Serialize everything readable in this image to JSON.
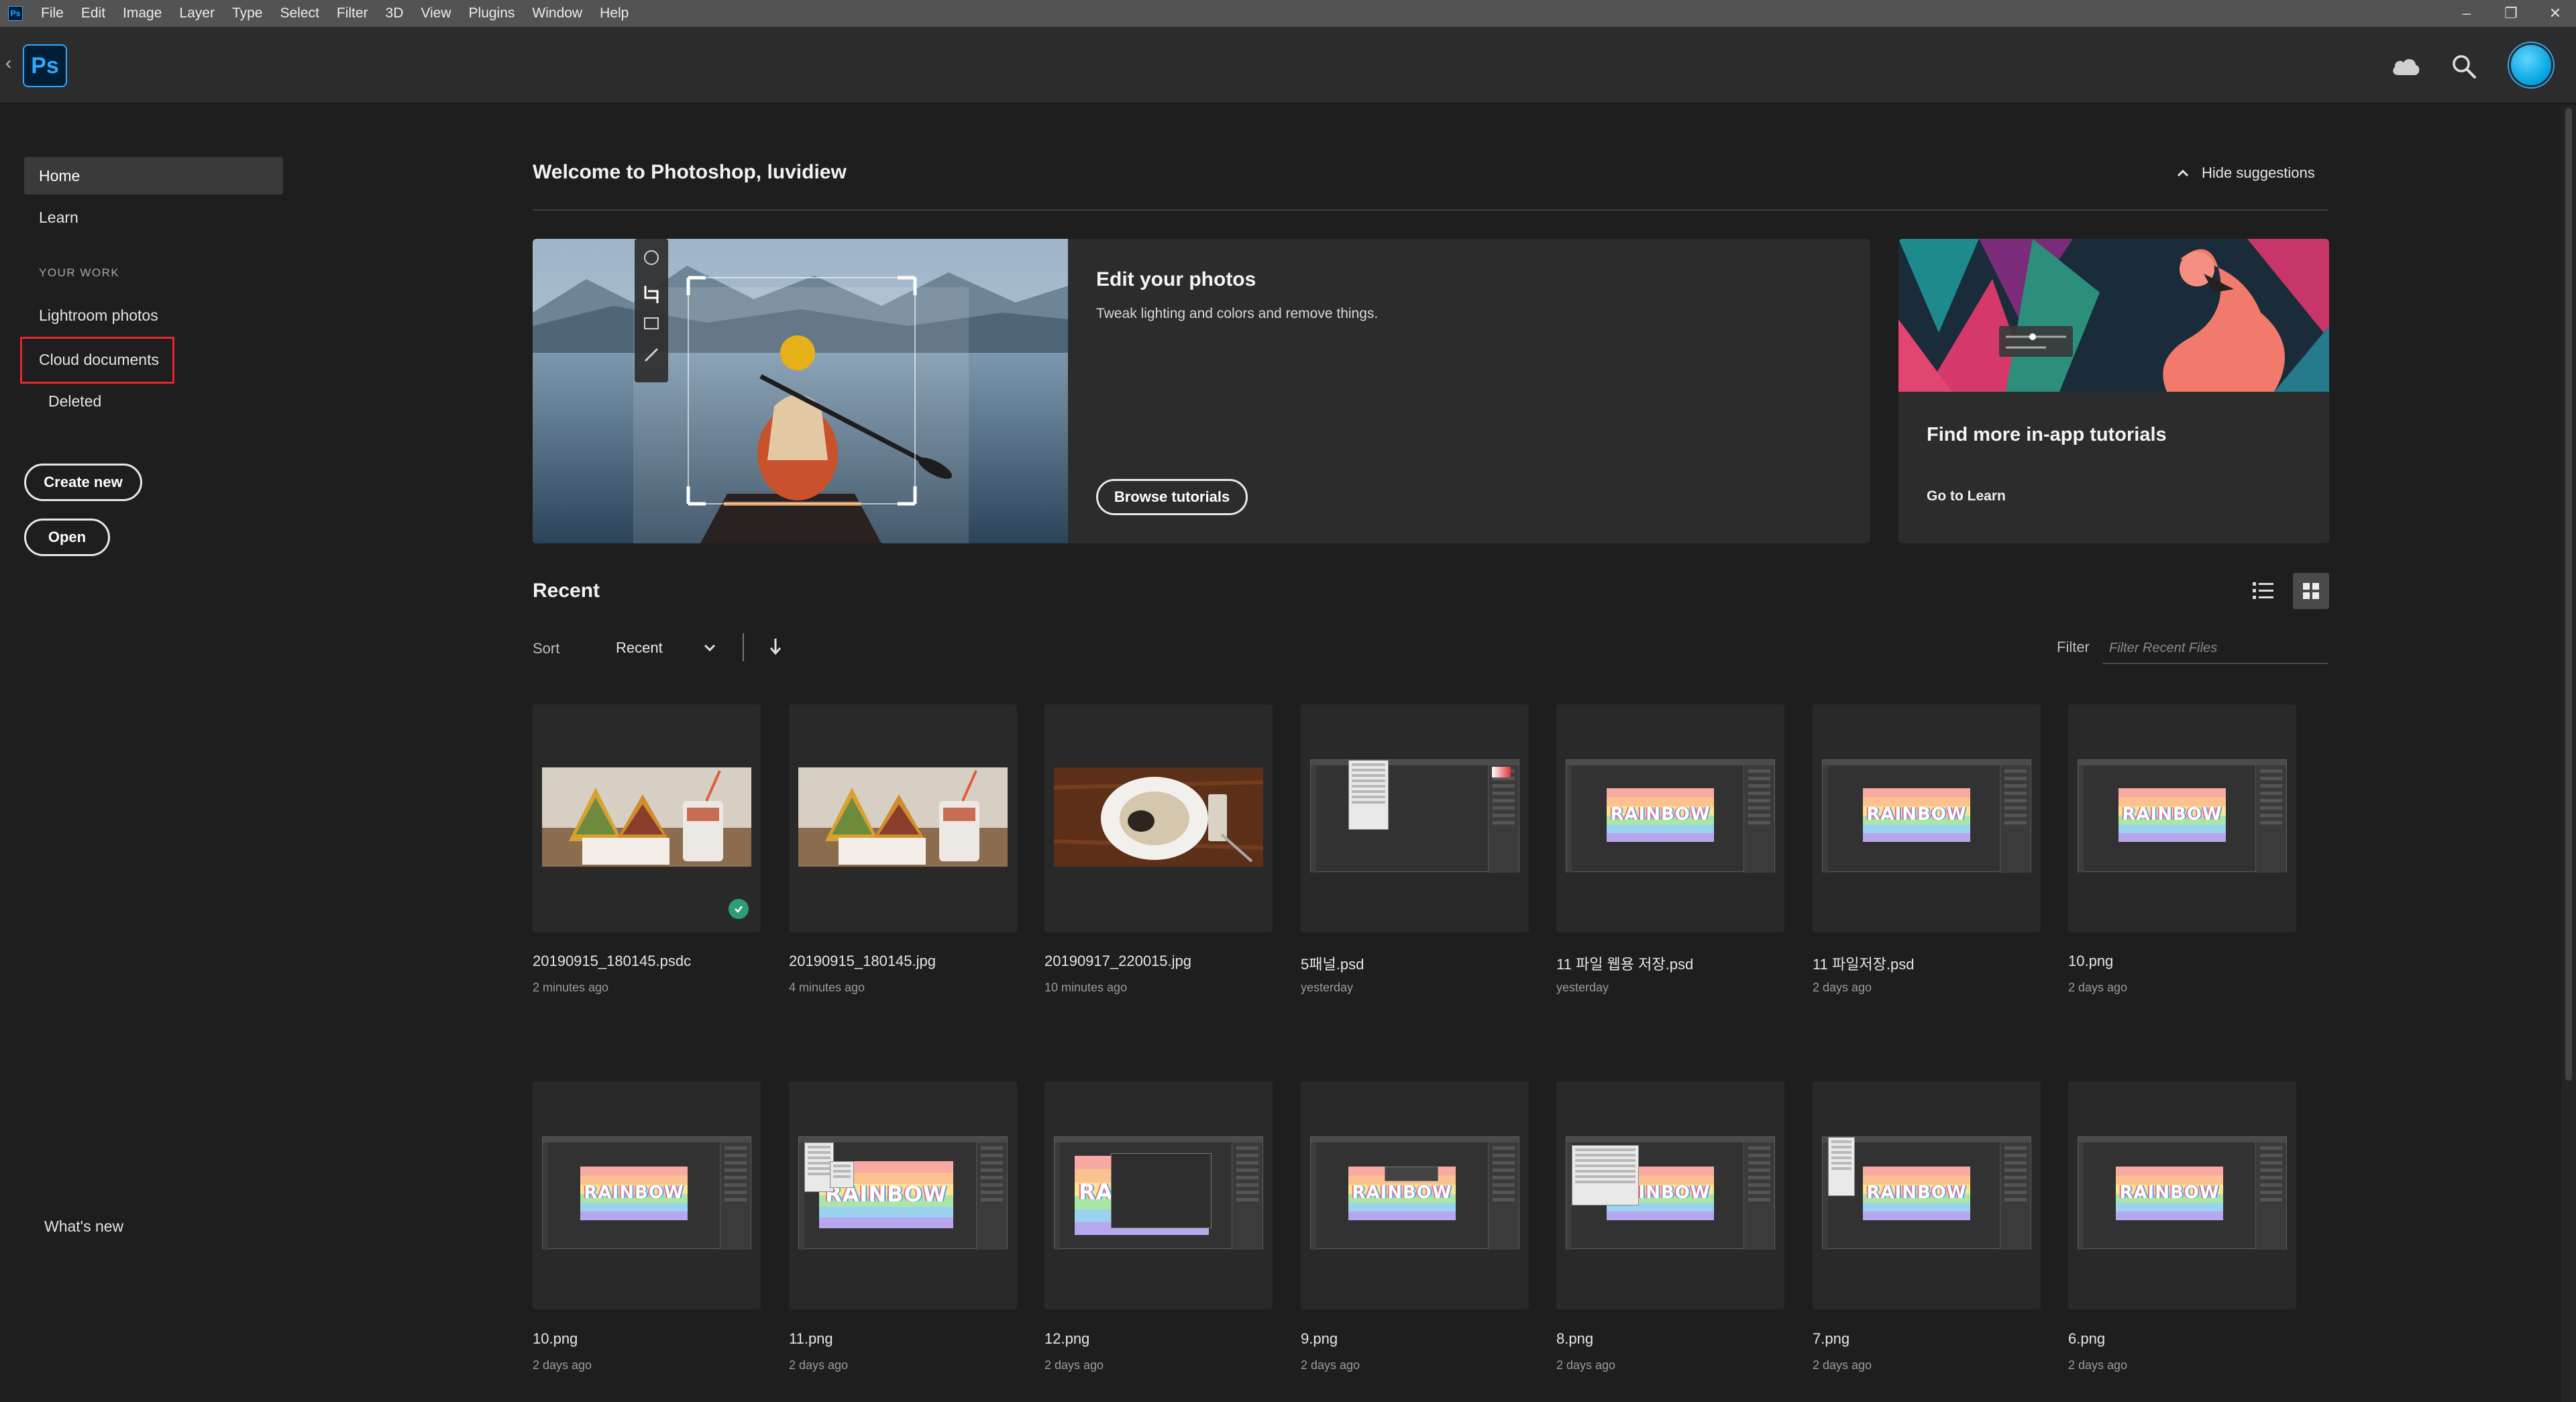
{
  "menubar": {
    "app_badge": "Ps",
    "items": [
      "File",
      "Edit",
      "Image",
      "Layer",
      "Type",
      "Select",
      "Filter",
      "3D",
      "View",
      "Plugins",
      "Window",
      "Help"
    ],
    "window_controls": [
      "minimize",
      "restore",
      "close"
    ]
  },
  "header": {
    "logo_text": "Ps",
    "icons": [
      "back-icon",
      "cloud-icon",
      "search-icon",
      "avatar"
    ]
  },
  "sidebar": {
    "items": [
      {
        "label": "Home",
        "active": true
      },
      {
        "label": "Learn",
        "active": false
      }
    ],
    "section_label": "YOUR WORK",
    "work_items": [
      {
        "label": "Lightroom photos"
      },
      {
        "label": "Cloud documents",
        "highlighted": true
      },
      {
        "label": "Deleted"
      }
    ],
    "create_new": "Create new",
    "open": "Open",
    "whats_new": "What's new"
  },
  "main": {
    "welcome_title": "Welcome to Photoshop, luvidiew",
    "hide_suggestions": "Hide suggestions",
    "edit_card": {
      "title": "Edit your photos",
      "subtitle": "Tweak lighting and colors and remove things.",
      "button": "Browse tutorials"
    },
    "learn_card": {
      "title": "Find more in-app tutorials",
      "link": "Go to Learn"
    },
    "recent": {
      "title": "Recent",
      "sort_label": "Sort",
      "sort_value": "Recent",
      "filter_label": "Filter",
      "filter_placeholder": "Filter Recent Files",
      "view_modes": [
        "list",
        "grid"
      ],
      "active_view": "grid",
      "files": [
        {
          "name": "20190915_180145.psdc",
          "time": "2 minutes ago",
          "synced": true
        },
        {
          "name": "20190915_180145.jpg",
          "time": "4 minutes ago"
        },
        {
          "name": "20190917_220015.jpg",
          "time": "10 minutes ago"
        },
        {
          "name": "5패널.psd",
          "time": "yesterday"
        },
        {
          "name": "11 파일 웹용 저장.psd",
          "time": "yesterday"
        },
        {
          "name": "11 파일저장.psd",
          "time": "2 days ago"
        },
        {
          "name": "10.png",
          "time": "2 days ago"
        },
        {
          "name": "10.png",
          "time": "2 days ago"
        },
        {
          "name": "11.png",
          "time": "2 days ago"
        },
        {
          "name": "12.png",
          "time": "2 days ago"
        },
        {
          "name": "9.png",
          "time": "2 days ago"
        },
        {
          "name": "8.png",
          "time": "2 days ago"
        },
        {
          "name": "7.png",
          "time": "2 days ago"
        },
        {
          "name": "6.png",
          "time": "2 days ago"
        }
      ],
      "thumb_text": "RAINBOW"
    }
  },
  "colors": {
    "accent": "#31a8ff",
    "highlight_box": "#e5262c",
    "sync_badge": "#2d9d78",
    "background": "#1e1e1e",
    "card": "#2c2c2c"
  }
}
